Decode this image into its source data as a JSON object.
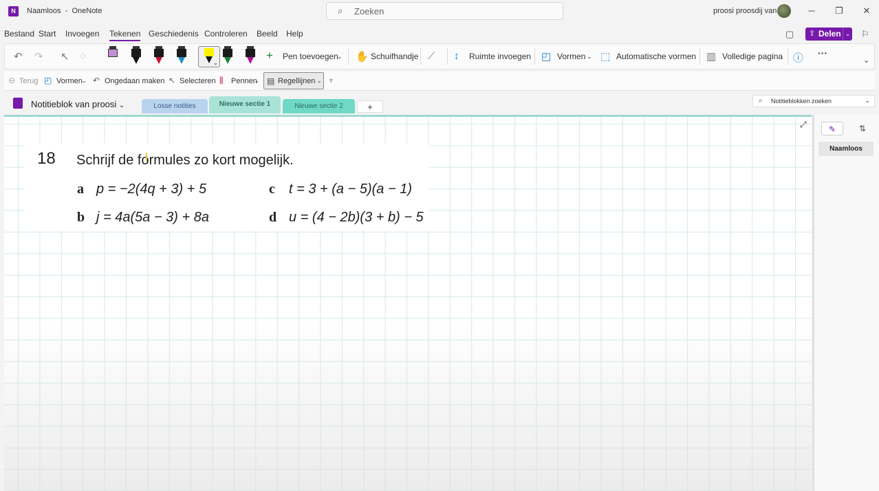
{
  "window": {
    "doc_title": "Naamloos",
    "separator": "-",
    "app_name": "OneNote",
    "search_placeholder": "Zoeken",
    "user_name": "proosi proosdij van"
  },
  "menu": [
    "Bestand",
    "Start",
    "Invoegen",
    "Tekenen",
    "Geschiedenis",
    "Controleren",
    "Beeld",
    "Help"
  ],
  "active_menu": "Tekenen",
  "share_label": "Delen",
  "ribbon": {
    "add_pen": "Pen toevoegen",
    "hand": "Schuifhandje",
    "insert_space": "Ruimte invoegen",
    "shapes": "Vormen",
    "auto_shapes": "Automatische vormen",
    "full_page": "Volledige pagina",
    "more": "···",
    "pen_colors": [
      "#c38fd4",
      "#1a1a1a",
      "#c8102e",
      "#1e90c8",
      "#fff200",
      "#1a7f3c",
      "#b0129a"
    ]
  },
  "drawbar": {
    "back": "Terug",
    "shapes": "Vormen",
    "undo": "Ongedaan maken",
    "select": "Selecteren",
    "pens": "Pennen",
    "rules": "Regellijnen"
  },
  "notebook": {
    "name": "Notitieblok van proosi",
    "tabs": [
      {
        "label": "Losse notities",
        "color": "#b9d3ef",
        "text_color": "#3b5d85"
      },
      {
        "label": "Nieuwe sectie 1",
        "color": "#a9e3d8",
        "text_color": "#2d6f63"
      },
      {
        "label": "Nieuwe sectie 2",
        "color": "#6fd8c6",
        "text_color": "#2d6f63"
      }
    ],
    "add_tab": "+",
    "search_placeholder": "Notitieblokken zoeken"
  },
  "exercise": {
    "number": "18",
    "title": "Schrijf de formules zo kort mogelijk.",
    "items": [
      {
        "letter": "a",
        "formula": "p = −2(4q + 3) + 5"
      },
      {
        "letter": "c",
        "formula": "t = 3 + (a − 5)(a − 1)"
      },
      {
        "letter": "b",
        "formula": "j = 4a(5a − 3) + 8a"
      },
      {
        "letter": "d",
        "formula": "u = (4 − 2b)(3 + b) − 5"
      }
    ]
  },
  "pages_pane": {
    "items": [
      "Naamloos"
    ]
  }
}
